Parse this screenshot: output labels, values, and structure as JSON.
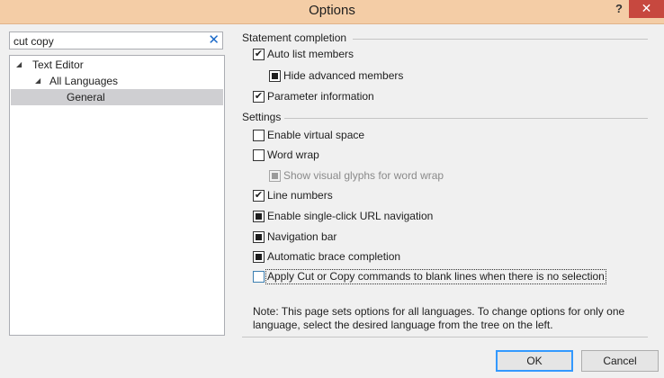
{
  "window": {
    "title": "Options",
    "help": "?",
    "close": "✕"
  },
  "search": {
    "value": "cut copy",
    "clear": "✕"
  },
  "tree": [
    {
      "label": "Text Editor",
      "arrow": "◢",
      "selected": false
    },
    {
      "label": "All Languages",
      "arrow": "◢",
      "selected": false
    },
    {
      "label": "General",
      "arrow": "",
      "selected": true
    }
  ],
  "groups": {
    "statement": "Statement completion",
    "settings": "Settings"
  },
  "options": [
    {
      "label": "Auto list members",
      "state": "checked"
    },
    {
      "label": "Hide advanced members",
      "state": "indeterminate"
    },
    {
      "label": "Parameter information",
      "state": "checked"
    },
    {
      "label": "Enable virtual space",
      "state": "unchecked"
    },
    {
      "label": "Word wrap",
      "state": "unchecked"
    },
    {
      "label": "Show visual glyphs for word wrap",
      "state": "indeterminate-disabled"
    },
    {
      "label": "Line numbers",
      "state": "checked"
    },
    {
      "label": "Enable single-click URL navigation",
      "state": "indeterminate"
    },
    {
      "label": "Navigation bar",
      "state": "indeterminate"
    },
    {
      "label": "Automatic brace completion",
      "state": "indeterminate"
    },
    {
      "label": "Apply Cut or Copy commands to blank lines when there is no selection",
      "state": "unchecked-focus"
    }
  ],
  "note": "Note: This page sets options for all languages. To change options for only one language, select the desired language from the tree on the left.",
  "buttons": {
    "ok": "OK",
    "cancel": "Cancel"
  }
}
